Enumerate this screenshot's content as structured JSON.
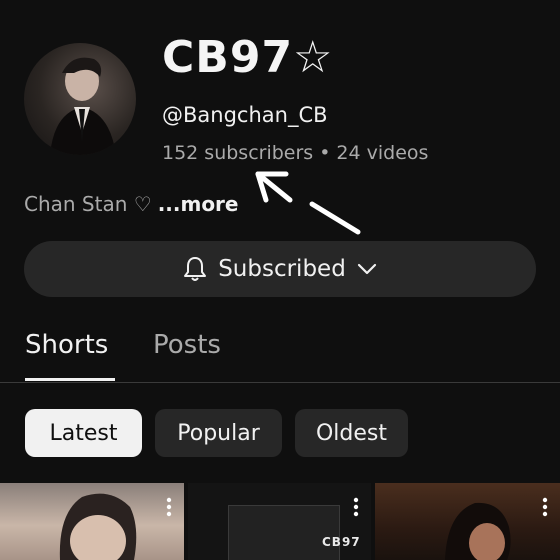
{
  "channel": {
    "name": "CB97☆",
    "handle": "@Bangchan_CB",
    "subscribers": "152 subscribers",
    "videos": "24 videos",
    "separator": "•",
    "description": "Chan Stan ♡",
    "more_label": "...more"
  },
  "subscribe": {
    "label": "Subscribed",
    "icon": "bell-icon",
    "dropdown_icon": "chevron-down-icon"
  },
  "tabs": [
    {
      "label": "Shorts",
      "active": true
    },
    {
      "label": "Posts",
      "active": false
    }
  ],
  "filters": [
    {
      "label": "Latest",
      "selected": true
    },
    {
      "label": "Popular",
      "selected": false
    },
    {
      "label": "Oldest",
      "selected": false
    }
  ],
  "thumbnails": [
    {
      "watermark": ""
    },
    {
      "watermark": "CB97"
    },
    {
      "watermark": ""
    }
  ],
  "colors": {
    "background": "#0f0f0f",
    "surface": "#272727",
    "text_primary": "#f1f1f1",
    "text_secondary": "#aaaaaa",
    "chip_selected_bg": "#f1f1f1"
  }
}
